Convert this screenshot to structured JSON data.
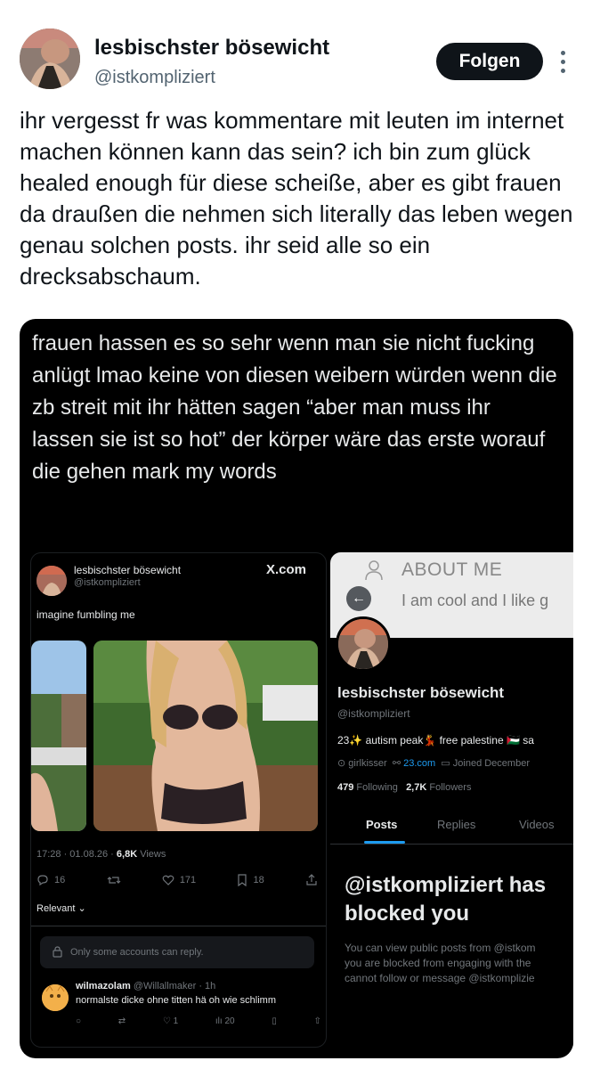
{
  "post": {
    "author_name": "lesbischster bösewicht",
    "author_handle": "@istkompliziert",
    "follow_label": "Folgen",
    "text": "ihr vergesst fr was kommentare mit leuten im internet machen können kann das sein? ich bin zum glück healed enough für diese scheiße, aber es gibt frauen da draußen die nehmen sich literally das leben wegen genau solchen posts. ihr seid alle so ein drecksabschaum."
  },
  "media": {
    "quote_text": "frauen hassen es so sehr wenn man sie nicht fucking anlügt lmao keine von diesen weibern würden wenn die zb streit mit ihr hätten sagen “aber man muss ihr lassen sie ist so hot” der körper wäre das erste worauf die gehen mark my words",
    "left_card": {
      "author_name": "lesbischster bösewicht",
      "author_handle": "@istkompliziert",
      "site": "X.com",
      "text": "imagine fumbling me",
      "time": "17:28 · 01.08.26 ·",
      "views_count": "6,8K",
      "views_label": "Views",
      "replies": "16",
      "likes": "171",
      "bookmarks": "18",
      "relevant": "Relevant",
      "only_some": "Only some accounts can reply.",
      "reply_name": "wilmazolam",
      "reply_handle": "@Willallmaker · 1h",
      "reply_text": "normalste dicke ohne titten hä oh wie schlimm",
      "reply_likes": "1",
      "reply_views": "20"
    },
    "right_card": {
      "about_title": "ABOUT ME",
      "about_text": "I am cool and I like g",
      "profile_name": "lesbischster bösewicht",
      "profile_handle": "@istkompliziert",
      "bio": "23✨ autism peak💃 free palestine 🇵🇸 sa",
      "location": "girlkisser",
      "link": "23.com",
      "joined": "Joined December",
      "following_count": "479",
      "following_label": "Following",
      "followers_count": "2,7K",
      "followers_label": "Followers",
      "tabs": [
        "Posts",
        "Replies",
        "Videos"
      ],
      "blocked_title_1": "@istkompliziert has",
      "blocked_title_2": "blocked you",
      "blocked_sub_1": "You can view public posts from @istkom",
      "blocked_sub_2": "you are blocked from engaging with the",
      "blocked_sub_3": "cannot follow or message @istkomplizie"
    }
  }
}
